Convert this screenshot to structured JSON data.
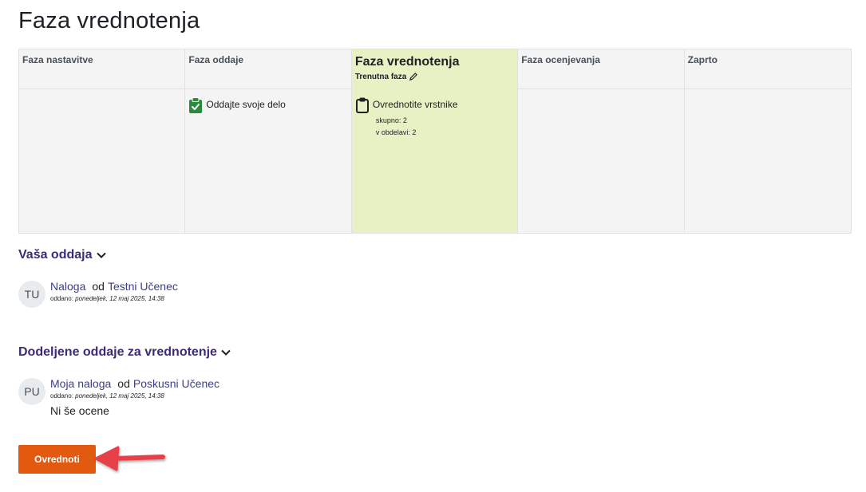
{
  "page": {
    "title": "Faza vrednotenja"
  },
  "phases": [
    {
      "name": "Faza nastavitve",
      "active": false
    },
    {
      "name": "Faza oddaje",
      "active": false,
      "task": {
        "label": "Oddajte svoje delo",
        "icon": "check-clipboard-icon",
        "color": "#2b8a3e"
      }
    },
    {
      "name": "Faza vrednotenja",
      "active": true,
      "current_label": "Trenutna faza",
      "current_icon": "pencil-icon",
      "task": {
        "label": "Ovrednotite vrstnike",
        "icon": "clipboard-icon",
        "info": [
          "skupno: 2",
          "v obdelavi: 2"
        ]
      }
    },
    {
      "name": "Faza ocenjevanja",
      "active": false
    },
    {
      "name": "Zaprto",
      "active": false
    }
  ],
  "your_submission": {
    "heading": "Vaša oddaja",
    "initials": "TU",
    "title": "Naloga",
    "by": "od",
    "author": "Testni Učenec",
    "submitted_label": "oddano:",
    "submitted_date": "ponedeljek, 12 maj 2025, 14:38"
  },
  "assigned": {
    "heading": "Dodeljene oddaje za vrednotenje",
    "initials": "PU",
    "title": "Moja naloga",
    "by": "od",
    "author": "Poskusni Učenec",
    "submitted_label": "oddano:",
    "submitted_date": "ponedeljek, 12 maj 2025, 14:38",
    "grade_status": "Ni še ocene",
    "button_label": "Ovrednoti"
  },
  "colors": {
    "accent": "#e25a0f",
    "heading": "#3c2a78",
    "active_phase": "#e7f1c4",
    "annotation_arrow": "#e8404a"
  }
}
